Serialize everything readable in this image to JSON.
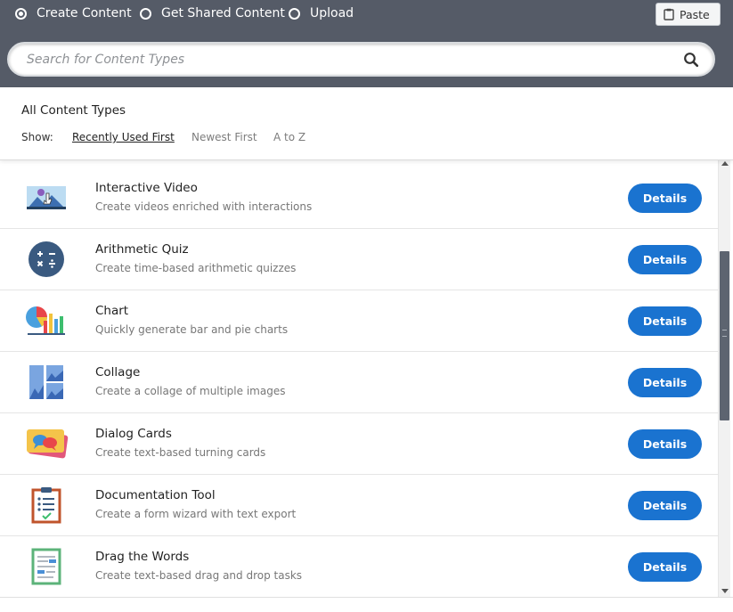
{
  "tabs": [
    {
      "label": "Create Content",
      "checked": true
    },
    {
      "label": "Get Shared Content",
      "checked": false
    },
    {
      "label": "Upload",
      "checked": false
    }
  ],
  "paste": {
    "label": "Paste",
    "icon": "clipboard-icon"
  },
  "search": {
    "placeholder": "Search for Content Types",
    "icon": "search-icon"
  },
  "section": {
    "title": "All Content Types",
    "show_label": "Show:",
    "sort_options": [
      {
        "label": "Recently Used First",
        "active": true
      },
      {
        "label": "Newest First",
        "active": false
      },
      {
        "label": "A to Z",
        "active": false
      }
    ]
  },
  "items": [
    {
      "title": "Interactive Video",
      "description": "Create videos enriched with interactions",
      "button": "Details",
      "icon": "interactive-video-icon"
    },
    {
      "title": "Arithmetic Quiz",
      "description": "Create time-based arithmetic quizzes",
      "button": "Details",
      "icon": "arithmetic-quiz-icon"
    },
    {
      "title": "Chart",
      "description": "Quickly generate bar and pie charts",
      "button": "Details",
      "icon": "chart-icon"
    },
    {
      "title": "Collage",
      "description": "Create a collage of multiple images",
      "button": "Details",
      "icon": "collage-icon"
    },
    {
      "title": "Dialog Cards",
      "description": "Create text-based turning cards",
      "button": "Details",
      "icon": "dialog-cards-icon"
    },
    {
      "title": "Documentation Tool",
      "description": "Create a form wizard with text export",
      "button": "Details",
      "icon": "documentation-tool-icon"
    },
    {
      "title": "Drag the Words",
      "description": "Create text-based drag and drop tasks",
      "button": "Details",
      "icon": "drag-the-words-icon"
    }
  ],
  "colors": {
    "topbar": "#555b67",
    "accent": "#1a73d0"
  }
}
